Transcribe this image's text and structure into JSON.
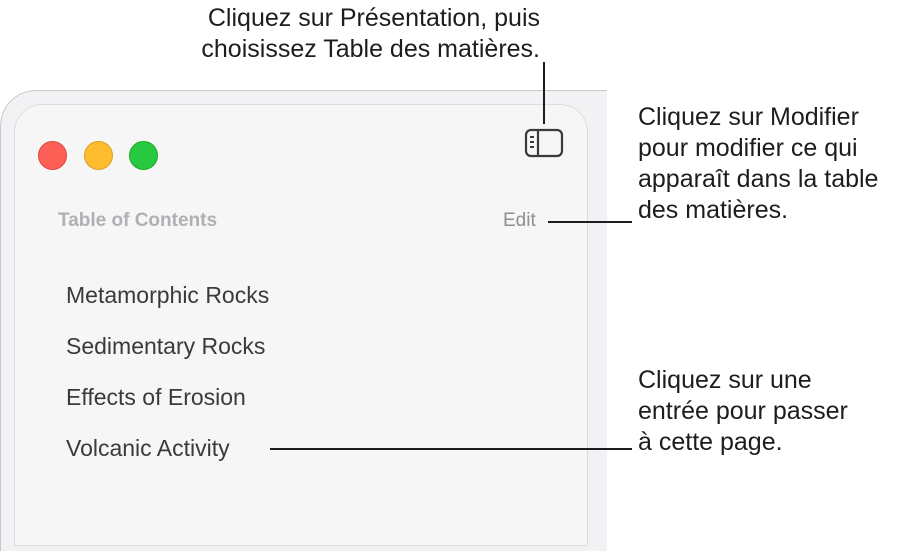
{
  "callouts": {
    "presentation": {
      "line1": "Cliquez sur Présentation, puis",
      "line2": "choisissez Table des matières."
    },
    "edit": {
      "line1": "Cliquez sur Modifier",
      "line2": "pour modifier ce qui",
      "line3": "apparaît dans la table",
      "line4": "des matières."
    },
    "entry": {
      "line1": "Cliquez sur une",
      "line2": "entrée pour passer",
      "line3": "à cette page."
    }
  },
  "window": {
    "toolbar": {
      "sidebar_icon": "sidebar-icon"
    },
    "toc": {
      "heading": "Table of Contents",
      "edit_label": "Edit",
      "items": [
        {
          "label": "Metamorphic Rocks"
        },
        {
          "label": "Sedimentary Rocks"
        },
        {
          "label": "Effects of Erosion"
        },
        {
          "label": "Volcanic Activity"
        }
      ]
    }
  }
}
